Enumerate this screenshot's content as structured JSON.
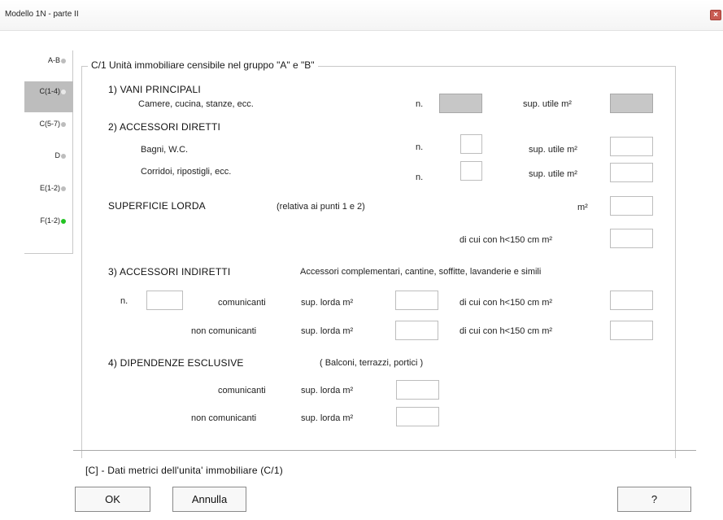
{
  "window": {
    "title": "Modello 1N  -   parte II",
    "close_glyph": "×"
  },
  "sidebar": {
    "tabs": [
      {
        "label": "A-B",
        "dot_color": "#bdbdbd",
        "active": false
      },
      {
        "label": "C(1-4)",
        "dot_color": "#e8e8e8",
        "active": true
      },
      {
        "label": "C(5-7)",
        "dot_color": "#bdbdbd",
        "active": false
      },
      {
        "label": "D",
        "dot_color": "#bdbdbd",
        "active": false
      },
      {
        "label": "E(1-2)",
        "dot_color": "#bdbdbd",
        "active": false
      },
      {
        "label": "F(1-2)",
        "dot_color": "#22c322",
        "active": false
      }
    ]
  },
  "group_title": "C/1  Unità immobiliare censibile nel gruppo \"A\" e \"B\"",
  "section1": {
    "heading": "1) VANI PRINCIPALI",
    "desc": "Camere, cucina, stanze, ecc.",
    "n_label": "n.",
    "sup_label": "sup. utile  m²",
    "n_value": "",
    "sup_value": ""
  },
  "section2": {
    "heading": "2) ACCESSORI DIRETTI",
    "row1": {
      "desc": "Bagni, W.C.",
      "n_label": "n.",
      "sup_label": "sup. utile  m²",
      "n_value": "",
      "sup_value": ""
    },
    "row2": {
      "desc": "Corridoi, ripostigli, ecc.",
      "n_label": "n.",
      "sup_label": "sup. utile  m²",
      "n_value": "",
      "sup_value": ""
    }
  },
  "superficie": {
    "heading": "SUPERFICIE LORDA",
    "note": "(relativa ai punti 1 e 2)",
    "m2_label": "m²",
    "h150_label": "di cui con h<150 cm  m²",
    "value": "",
    "h150_value": ""
  },
  "section3": {
    "heading": "3) ACCESSORI INDIRETTI",
    "desc": "Accessori complementari, cantine, soffitte, lavanderie e simili",
    "n_label": "n.",
    "n_value": "",
    "row1": {
      "label": "comunicanti",
      "sup_label": "sup. lorda m²",
      "h150_label": "di cui con h<150 cm  m²",
      "sup_value": "",
      "h150_value": ""
    },
    "row2": {
      "label": "non comunicanti",
      "sup_label": "sup. lorda m²",
      "h150_label": "di cui con h<150 cm  m²",
      "sup_value": "",
      "h150_value": ""
    }
  },
  "section4": {
    "heading": "4) DIPENDENZE ESCLUSIVE",
    "desc": "( Balconi, terrazzi, portici )",
    "row1": {
      "label": "comunicanti",
      "sup_label": "sup. lorda m²",
      "sup_value": ""
    },
    "row2": {
      "label": "non comunicanti",
      "sup_label": "sup. lorda m²",
      "sup_value": ""
    }
  },
  "footer": {
    "caption": "[C] - Dati metrici dell'unita' immobiliare (C/1)",
    "ok_label": "OK",
    "cancel_label": "Annulla",
    "help_label": "?"
  }
}
